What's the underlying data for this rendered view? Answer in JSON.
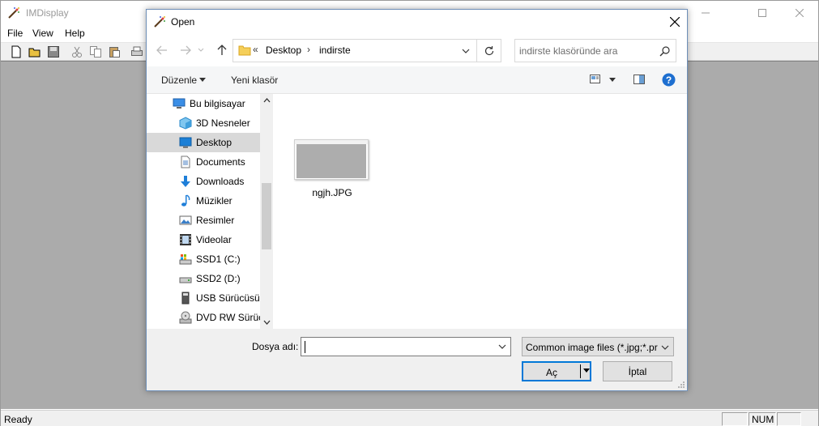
{
  "app": {
    "title": "IMDisplay",
    "menu": [
      "File",
      "View",
      "Help"
    ],
    "status": {
      "ready": "Ready",
      "num": "NUM"
    }
  },
  "dialog": {
    "title": "Open",
    "address": {
      "breadcrumb": [
        "Desktop",
        "indirste"
      ],
      "overflow": "«"
    },
    "search": {
      "placeholder": "indirste klasöründe ara"
    },
    "commands": {
      "organize": "Düzenle",
      "new_folder": "Yeni klasör"
    },
    "nav_items": [
      {
        "label": "Bu bilgisayar",
        "icon": "computer-icon",
        "selected": false
      },
      {
        "label": "3D Nesneler",
        "icon": "cube-icon",
        "selected": false
      },
      {
        "label": "Desktop",
        "icon": "desktop-icon",
        "selected": true
      },
      {
        "label": "Documents",
        "icon": "document-icon",
        "selected": false
      },
      {
        "label": "Downloads",
        "icon": "download-icon",
        "selected": false
      },
      {
        "label": "Müzikler",
        "icon": "music-icon",
        "selected": false
      },
      {
        "label": "Resimler",
        "icon": "picture-icon",
        "selected": false
      },
      {
        "label": "Videolar",
        "icon": "video-icon",
        "selected": false
      },
      {
        "label": "SSD1 (C:)",
        "icon": "drive-c-icon",
        "selected": false
      },
      {
        "label": "SSD2 (D:)",
        "icon": "drive-icon",
        "selected": false
      },
      {
        "label": "USB Sürücüsü (",
        "icon": "usb-drive-icon",
        "selected": false
      },
      {
        "label": "DVD RW Sürüc",
        "icon": "dvd-drive-icon",
        "selected": false
      }
    ],
    "files": [
      {
        "name": "ngjh.JPG"
      }
    ],
    "filename": {
      "label": "Dosya adı:",
      "value": ""
    },
    "filetype": {
      "selected": "Common image files (*.jpg;*.pr"
    },
    "buttons": {
      "open": "Aç",
      "cancel": "İptal"
    }
  },
  "colors": {
    "accent": "#0078d7",
    "selection": "#d9d9d9",
    "canvas": "#ababab"
  }
}
